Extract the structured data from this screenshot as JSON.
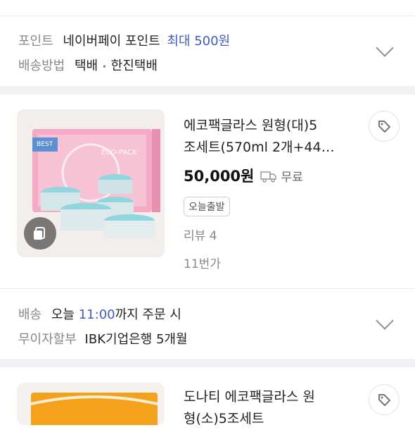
{
  "block1": {
    "point_label": "포인트",
    "point_text": "네이버페이 포인트",
    "point_highlight": "최대 500원",
    "shipping_label": "배송방법",
    "shipping_method": "택배",
    "shipping_sep": "•",
    "shipping_company": "한진택배"
  },
  "product1": {
    "title_line1": "에코팩글라스 원형(대)5",
    "title_line2": "조세트(570ml 2개+44…",
    "price": "50,000원",
    "shipping_fee": "무료",
    "badge": "오늘출발",
    "review": "리뷰 4",
    "seller": "11번가",
    "thumb_brand": "ECO-PACK",
    "thumb_tag": "BEST"
  },
  "block2": {
    "delivery_label": "배송",
    "delivery_today": "오늘",
    "delivery_time": "11:00",
    "delivery_rest": "까지 주문 시",
    "installment_label": "무이자할부",
    "installment_text": "IBK기업은행 5개월"
  },
  "product2": {
    "title_line1": "도나티 에코팩글라스 원",
    "title_line2": "형(소)5조세트"
  },
  "colors": {
    "accent_blue": "#3d5bd9",
    "band_gray": "#f0f1f4",
    "price_black": "#111111"
  },
  "icons": [
    "chevron-down-icon",
    "wishlist-tag-icon",
    "truck-icon",
    "copy-icon"
  ]
}
